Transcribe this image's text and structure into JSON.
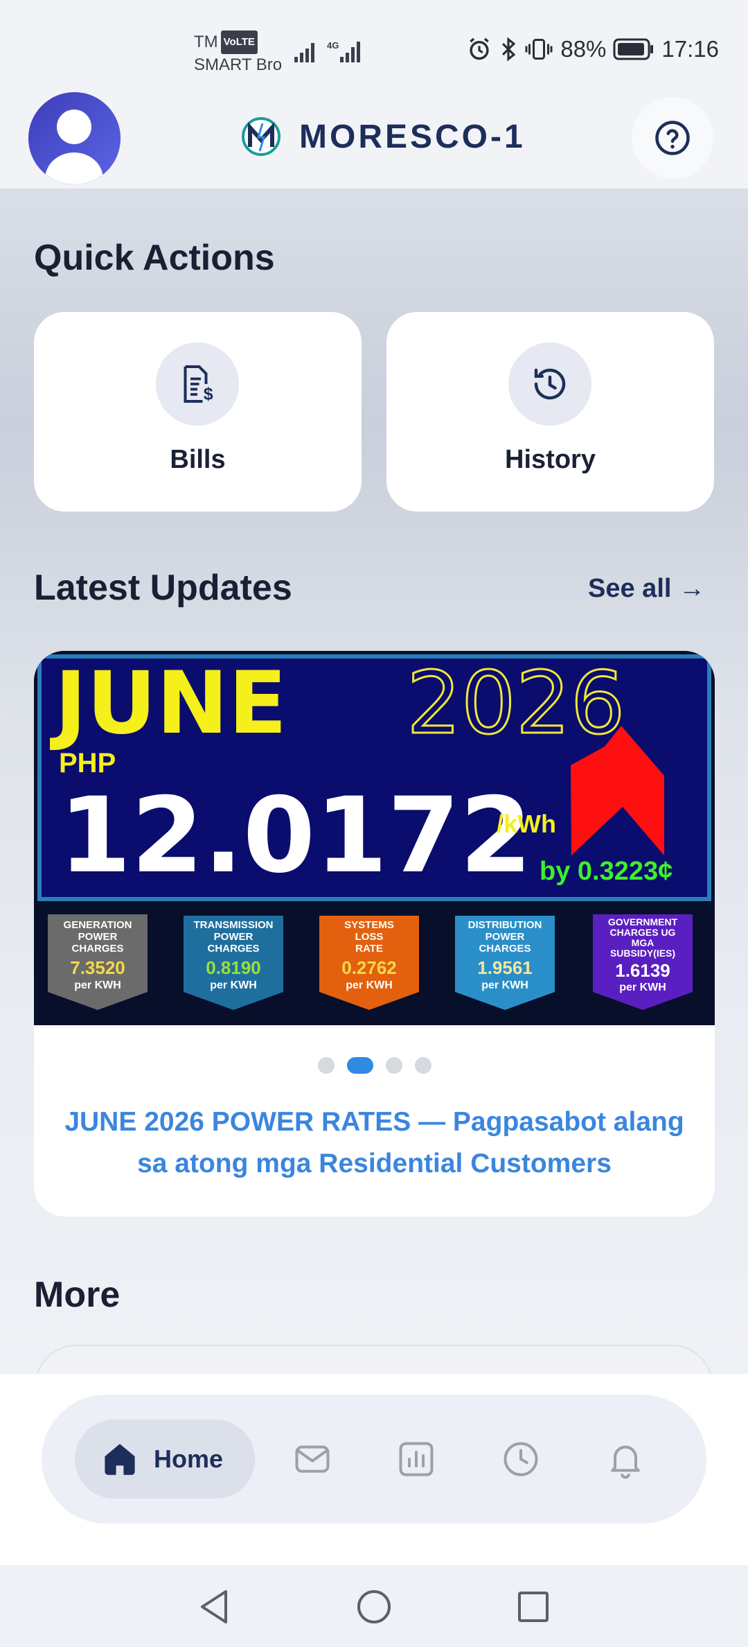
{
  "status_bar": {
    "carrier_line1": "TM",
    "volte": "VoLTE",
    "carrier_line2": "SMART Bro",
    "network": "4G",
    "battery": "88%",
    "time": "17:16"
  },
  "header": {
    "title": "MORESCO-1",
    "avatar_icon": "user-avatar-icon",
    "help_icon": "help-circle-icon"
  },
  "quick_actions": {
    "title": "Quick Actions",
    "items": [
      {
        "label": "Bills",
        "icon": "bill-dollar-icon"
      },
      {
        "label": "History",
        "icon": "history-clock-icon"
      }
    ]
  },
  "updates": {
    "title": "Latest Updates",
    "see_all": "See all →",
    "banner": {
      "month": "JUNE",
      "year": "2026",
      "currency": "PHP",
      "rate": "12.0172",
      "unit": "/kWh",
      "change": "by 0.3223",
      "change_symbol": "¢",
      "components": [
        {
          "l1": "GENERATION",
          "l2": "POWER",
          "l3": "CHARGES",
          "l4": "",
          "value": "7.3520",
          "unit": "per KWH",
          "color": "#6b6b6b"
        },
        {
          "l1": "TRANSMISSION",
          "l2": "POWER",
          "l3": "CHARGES",
          "l4": "",
          "value": "0.8190",
          "unit": "per KWH",
          "color": "#1f6f9e"
        },
        {
          "l1": "SYSTEMS",
          "l2": "LOSS",
          "l3": "RATE",
          "l4": "",
          "value": "0.2762",
          "unit": "per KWH",
          "color": "#e2600e"
        },
        {
          "l1": "DISTRIBUTION",
          "l2": "POWER",
          "l3": "CHARGES",
          "l4": "",
          "value": "1.9561",
          "unit": "per KWH",
          "color": "#2a8fc8"
        },
        {
          "l1": "GOVERNMENT",
          "l2": "CHARGES UG",
          "l3": "MGA",
          "l4": "SUBSIDY(IES)",
          "value": "1.6139",
          "unit": "per KWH",
          "color": "#5a1fc0"
        }
      ]
    },
    "carousel_active_index": 1,
    "carousel_count": 4,
    "caption": "JUNE 2026 POWER RATES — Pagpasabot alang sa atong mga Residential Customers"
  },
  "more": {
    "title": "More"
  },
  "bottom_nav": {
    "items": [
      {
        "label": "Home",
        "icon": "home-icon",
        "active": true
      },
      {
        "label": "",
        "icon": "mail-icon",
        "active": false
      },
      {
        "label": "",
        "icon": "chart-icon",
        "active": false
      },
      {
        "label": "",
        "icon": "clock-icon",
        "active": false
      },
      {
        "label": "",
        "icon": "bell-icon",
        "active": false
      }
    ]
  },
  "colors": {
    "brand": "#1d2e5a",
    "accent": "#2f8ae2",
    "caption": "#3b86dd"
  }
}
